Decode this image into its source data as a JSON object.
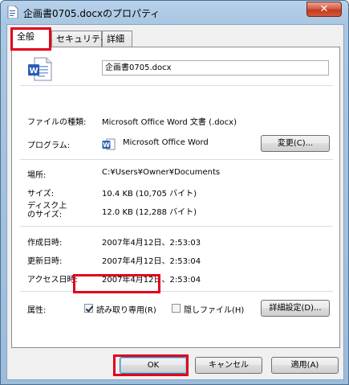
{
  "window": {
    "title": "企画書0705.docxのプロパティ",
    "close_glyph": "✕"
  },
  "tabs": [
    {
      "label": "全般",
      "active": true
    },
    {
      "label": "セキュリティ",
      "active": false
    },
    {
      "label": "詳細",
      "active": false
    }
  ],
  "general": {
    "file_name": "企画書0705.docx",
    "file_type_label": "ファイルの種類:",
    "file_type_value": "Microsoft Office Word 文書 (.docx)",
    "program_label": "プログラム:",
    "program_value": "Microsoft Office Word",
    "change_button": "変更(C)...",
    "location_label": "場所:",
    "location_value": "C:¥Users¥Owner¥Documents",
    "size_label": "サイズ:",
    "size_value": "10.4 KB (10,705 バイト)",
    "size_on_disk_label_1": "ディスク上",
    "size_on_disk_label_2": "のサイズ:",
    "size_on_disk_value": "12.0 KB (12,288 バイト)",
    "created_label": "作成日時:",
    "created_value": "2007年4月12日、2:53:03",
    "modified_label": "更新日時:",
    "modified_value": "2007年4月12日、2:53:04",
    "accessed_label": "アクセス日時:",
    "accessed_value": "2007年4月12日、2:53:04",
    "attributes_label": "属性:",
    "readonly_label": "読み取り専用(R)",
    "readonly_checked": true,
    "hidden_label": "隠しファイル(H)",
    "hidden_checked": false,
    "advanced_button": "詳細設定(D)..."
  },
  "footer": {
    "ok_button": "OK",
    "cancel_button": "キャンセル",
    "apply_button": "適用(A)"
  },
  "icons": {
    "document": "word-document-icon",
    "program": "word-program-icon"
  },
  "colors": {
    "highlight": "#e3001b",
    "close_button": "#c13b1e"
  }
}
